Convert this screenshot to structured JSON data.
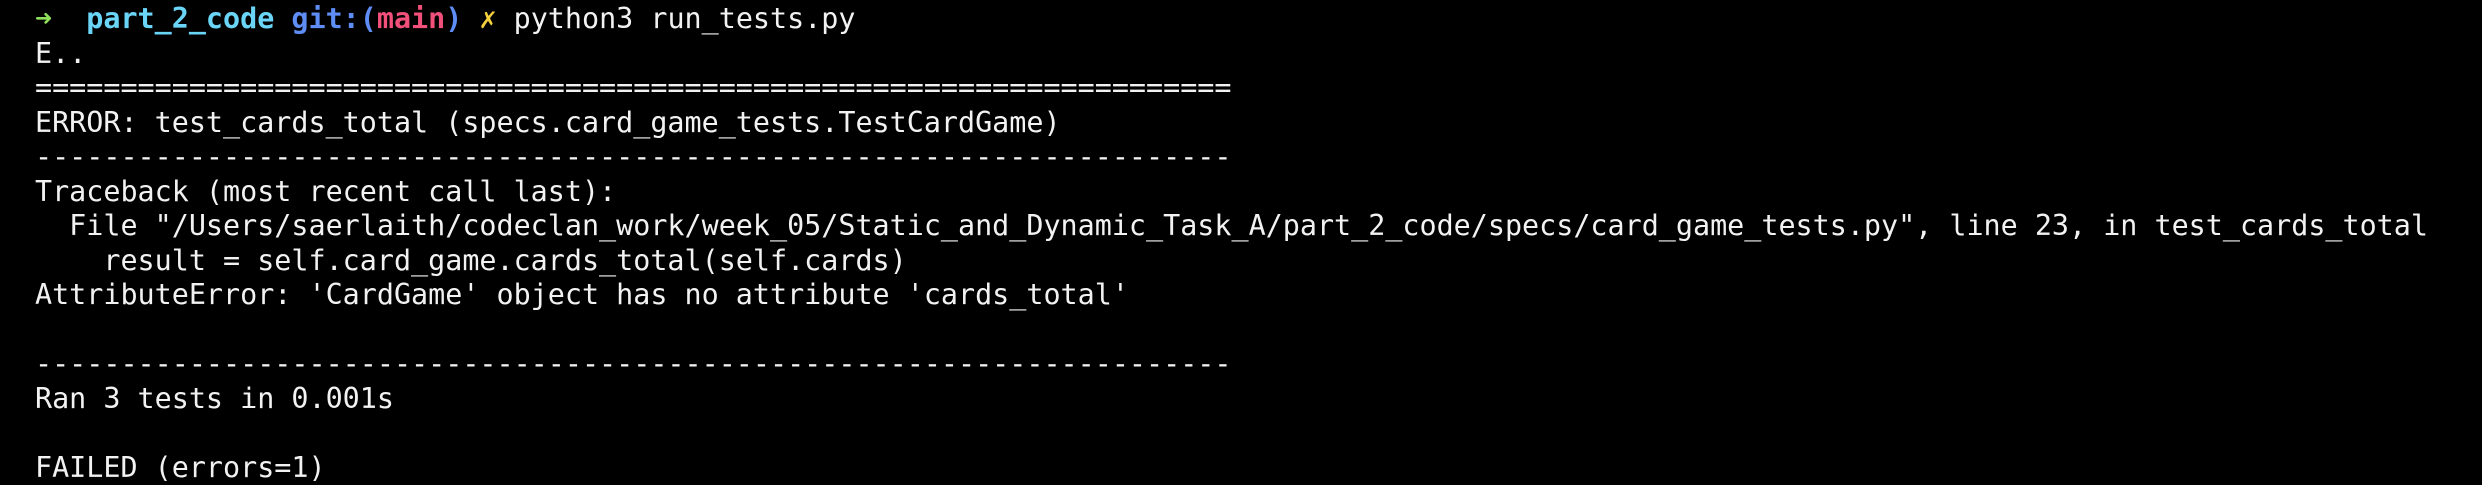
{
  "prompt": {
    "arrow": "➜",
    "directory": "part_2_code",
    "git_label": "git:(",
    "branch": "main",
    "git_close": ")",
    "dirty_mark": "✗",
    "command": "python3 run_tests.py"
  },
  "output": {
    "progress": "E..",
    "separator_double": "======================================================================",
    "error_header": "ERROR: test_cards_total (specs.card_game_tests.TestCardGame)",
    "separator_single": "----------------------------------------------------------------------",
    "traceback_header": "Traceback (most recent call last):",
    "traceback_file": "  File \"/Users/saerlaith/codeclan_work/week_05/Static_and_Dynamic_Task_A/part_2_code/specs/card_game_tests.py\", line 23, in test_cards_total",
    "traceback_code": "    result = self.card_game.cards_total(self.cards)",
    "error_message": "AttributeError: 'CardGame' object has no attribute 'cards_total'",
    "separator_bottom": "----------------------------------------------------------------------",
    "summary": "Ran 3 tests in 0.001s",
    "result": "FAILED (errors=1)"
  },
  "colors": {
    "background": "#000000",
    "text": "#f2f2f2",
    "prompt_arrow": "#8fe05a",
    "directory": "#6ad5f7",
    "git_label": "#5f8df6",
    "branch": "#f0507a",
    "dirty_mark": "#f4d03f"
  }
}
